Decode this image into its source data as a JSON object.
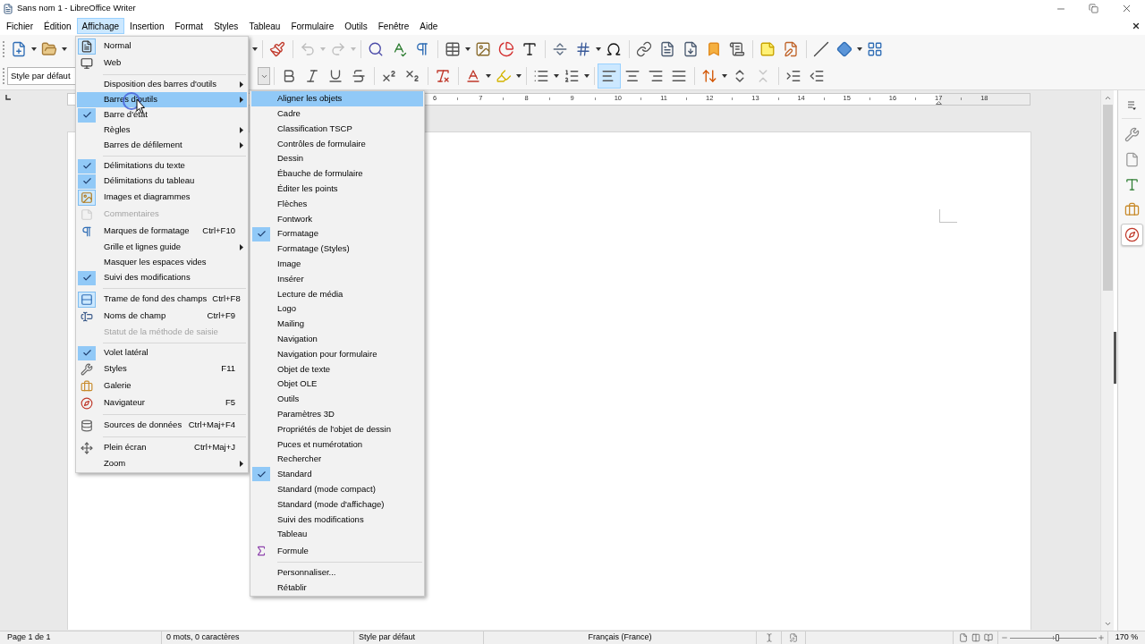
{
  "window": {
    "title": "Sans nom 1 - LibreOffice Writer"
  },
  "menu_bar": [
    {
      "label": "Fichier",
      "selected": false
    },
    {
      "label": "Édition",
      "selected": false
    },
    {
      "label": "Affichage",
      "selected": true
    },
    {
      "label": "Insertion",
      "selected": false
    },
    {
      "label": "Format",
      "selected": false
    },
    {
      "label": "Styles",
      "selected": false
    },
    {
      "label": "Tableau",
      "selected": false
    },
    {
      "label": "Formulaire",
      "selected": false
    },
    {
      "label": "Outils",
      "selected": false
    },
    {
      "label": "Fenêtre",
      "selected": false
    },
    {
      "label": "Aide",
      "selected": false
    }
  ],
  "standard_toolbar": {
    "undo": {
      "disabled": true
    },
    "redo": {
      "disabled": true
    }
  },
  "formatting_toolbar": {
    "paragraph_style": "Style par défaut",
    "alignment": [
      {
        "kind": "left",
        "selected": true
      },
      {
        "kind": "center",
        "selected": false
      },
      {
        "kind": "right",
        "selected": false
      },
      {
        "kind": "justify",
        "selected": false
      }
    ],
    "paragraph_spacing": [
      {
        "kind": "increase",
        "disabled": false
      },
      {
        "kind": "decrease",
        "disabled": true
      }
    ]
  },
  "view_menu": {
    "groups": [
      [
        {
          "label": "Normal",
          "checked": true,
          "disabled": false,
          "submenu": false,
          "selected": false
        },
        {
          "label": "Web",
          "checked": false,
          "disabled": false,
          "submenu": false,
          "selected": false
        }
      ],
      [
        {
          "label": "Disposition des barres d'outils",
          "checked": false,
          "disabled": false,
          "submenu": true,
          "selected": false
        },
        {
          "label": "Barres d'outils",
          "checked": false,
          "disabled": false,
          "submenu": true,
          "selected": true
        },
        {
          "label": "Barre d'état",
          "checked": true,
          "disabled": false,
          "submenu": false,
          "selected": false
        },
        {
          "label": "Règles",
          "checked": false,
          "disabled": false,
          "submenu": true,
          "selected": false
        },
        {
          "label": "Barres de défilement",
          "checked": false,
          "disabled": false,
          "submenu": true,
          "selected": false
        }
      ],
      [
        {
          "label": "Délimitations du texte",
          "checked": true,
          "disabled": false,
          "submenu": false,
          "selected": false
        },
        {
          "label": "Délimitations du tableau",
          "checked": true,
          "disabled": false,
          "submenu": false,
          "selected": false
        },
        {
          "label": "Images et diagrammes",
          "checked": true,
          "disabled": false,
          "submenu": false,
          "selected": false
        },
        {
          "label": "Commentaires",
          "checked": false,
          "disabled": true,
          "submenu": false,
          "selected": false
        },
        {
          "label": "Marques de formatage",
          "shortcut": "Ctrl+F10",
          "checked": false,
          "disabled": false,
          "submenu": false,
          "selected": false
        },
        {
          "label": "Grille et lignes guide",
          "checked": false,
          "disabled": false,
          "submenu": true,
          "selected": false
        },
        {
          "label": "Masquer les espaces vides",
          "checked": false,
          "disabled": false,
          "submenu": false,
          "selected": false
        },
        {
          "label": "Suivi des modifications",
          "checked": true,
          "disabled": false,
          "submenu": false,
          "selected": false
        }
      ],
      [
        {
          "label": "Trame de fond des champs",
          "shortcut": "Ctrl+F8",
          "checked": true,
          "disabled": false,
          "submenu": false,
          "selected": false
        },
        {
          "label": "Noms de champ",
          "shortcut": "Ctrl+F9",
          "checked": false,
          "disabled": false,
          "submenu": false,
          "selected": false
        },
        {
          "label": "Statut de la méthode de saisie",
          "checked": false,
          "disabled": true,
          "submenu": false,
          "selected": false
        }
      ],
      [
        {
          "label": "Volet latéral",
          "checked": true,
          "disabled": false,
          "submenu": false,
          "selected": false
        },
        {
          "label": "Styles",
          "shortcut": "F11",
          "checked": false,
          "disabled": false,
          "submenu": false,
          "selected": false
        },
        {
          "label": "Galerie",
          "checked": false,
          "disabled": false,
          "submenu": false,
          "selected": false
        },
        {
          "label": "Navigateur",
          "shortcut": "F5",
          "checked": false,
          "disabled": false,
          "submenu": false,
          "selected": false
        }
      ],
      [
        {
          "label": "Sources de données",
          "shortcut": "Ctrl+Maj+F4",
          "checked": false,
          "disabled": false,
          "submenu": false,
          "selected": false
        }
      ],
      [
        {
          "label": "Plein écran",
          "shortcut": "Ctrl+Maj+J",
          "checked": false,
          "disabled": false,
          "submenu": false,
          "selected": false
        },
        {
          "label": "Zoom",
          "checked": false,
          "disabled": false,
          "submenu": true,
          "selected": false
        }
      ]
    ]
  },
  "toolbars_submenu": {
    "groups": [
      [
        {
          "label": "Aligner les objets",
          "checked": false,
          "selected": true
        },
        {
          "label": "Cadre",
          "checked": false,
          "selected": false
        },
        {
          "label": "Classification TSCP",
          "checked": false,
          "selected": false
        },
        {
          "label": "Contrôles de formulaire",
          "checked": false,
          "selected": false
        },
        {
          "label": "Dessin",
          "checked": false,
          "selected": false
        },
        {
          "label": "Ébauche de formulaire",
          "checked": false,
          "selected": false
        },
        {
          "label": "Éditer les points",
          "checked": false,
          "selected": false
        },
        {
          "label": "Flèches",
          "checked": false,
          "selected": false
        },
        {
          "label": "Fontwork",
          "checked": false,
          "selected": false
        },
        {
          "label": "Formatage",
          "checked": true,
          "selected": false
        },
        {
          "label": "Formatage (Styles)",
          "checked": false,
          "selected": false
        },
        {
          "label": "Image",
          "checked": false,
          "selected": false
        },
        {
          "label": "Insérer",
          "checked": false,
          "selected": false
        },
        {
          "label": "Lecture de média",
          "checked": false,
          "selected": false
        },
        {
          "label": "Logo",
          "checked": false,
          "selected": false
        },
        {
          "label": "Mailing",
          "checked": false,
          "selected": false
        },
        {
          "label": "Navigation",
          "checked": false,
          "selected": false
        },
        {
          "label": "Navigation pour formulaire",
          "checked": false,
          "selected": false
        },
        {
          "label": "Objet de texte",
          "checked": false,
          "selected": false
        },
        {
          "label": "Objet OLE",
          "checked": false,
          "selected": false
        },
        {
          "label": "Outils",
          "checked": false,
          "selected": false
        },
        {
          "label": "Paramètres 3D",
          "checked": false,
          "selected": false
        },
        {
          "label": "Propriétés de l'objet de dessin",
          "checked": false,
          "selected": false
        },
        {
          "label": "Puces et numérotation",
          "checked": false,
          "selected": false
        },
        {
          "label": "Rechercher",
          "checked": false,
          "selected": false
        },
        {
          "label": "Standard",
          "checked": true,
          "selected": false
        },
        {
          "label": "Standard (mode compact)",
          "checked": false,
          "selected": false
        },
        {
          "label": "Standard (mode d'affichage)",
          "checked": false,
          "selected": false
        },
        {
          "label": "Suivi des modifications",
          "checked": false,
          "selected": false
        },
        {
          "label": "Tableau",
          "checked": false,
          "selected": false
        },
        {
          "label": "Formule",
          "checked": false,
          "selected": false
        }
      ],
      [
        {
          "label": "Personnaliser...",
          "checked": false,
          "selected": false
        },
        {
          "label": "Rétablir",
          "checked": false,
          "selected": false
        }
      ]
    ]
  },
  "ruler": {
    "labels": [
      "6",
      "7",
      "8",
      "9",
      "10",
      "11",
      "12",
      "13",
      "14",
      "15",
      "16",
      "17",
      "18"
    ]
  },
  "sidebar": {
    "decks": [
      {
        "kind": "properties",
        "selected": false
      },
      {
        "kind": "page",
        "selected": false
      },
      {
        "kind": "styles",
        "selected": false
      },
      {
        "kind": "gallery",
        "selected": false
      },
      {
        "kind": "navigator",
        "selected": true
      }
    ]
  },
  "status_bar": {
    "page": "Page 1 de 1",
    "word_count": "0 mots, 0 caractères",
    "page_style": "Style par défaut",
    "language": "Français (France)",
    "zoom_slider": {
      "level": 0.55
    },
    "zoom": "170 %"
  }
}
